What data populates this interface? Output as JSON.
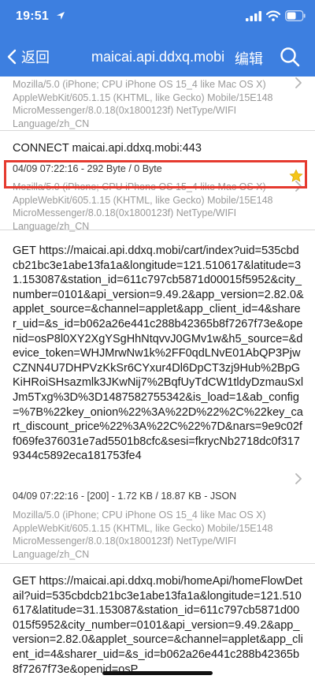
{
  "status": {
    "time": "19:51"
  },
  "nav": {
    "back_label": "返回",
    "title": "maicai.api.ddxq.mobi",
    "edit_label": "编辑"
  },
  "items": [
    {
      "ua": "Mozilla/5.0 (iPhone; CPU iPhone OS 15_4 like Mac OS X) AppleWebKit/605.1.15 (KHTML, like Gecko) Mobile/15E148 MicroMessenger/8.0.18(0x1800123f) NetType/WIFI Language/zh_CN"
    },
    {
      "request": "CONNECT maicai.api.ddxq.mobi:443",
      "meta": "04/09 07:22:16 - 292 Byte / 0 Byte",
      "ua": "Mozilla/5.0 (iPhone; CPU iPhone OS 15_4 like Mac OS X) AppleWebKit/605.1.15 (KHTML, like Gecko) Mobile/15E148 MicroMessenger/8.0.18(0x1800123f) NetType/WIFI Language/zh_CN"
    },
    {
      "request": "GET https://maicai.api.ddxq.mobi/cart/index?uid=535cbdcb21bc3e1abe13fa1a&longitude=121.510617&latitude=31.153087&station_id=611c797cb5871d00015f5952&city_number=0101&api_version=9.49.2&app_version=2.82.0&applet_source=&channel=applet&app_client_id=4&sharer_uid=&s_id=b062a26e441c288b42365b8f7267f73e&openid=osP8l0XY2XgYSgHhNtqvvJ0GMv1w&h5_source=&device_token=WHJMrwNw1k%2FF0qdLNvE01AbQP3PjwCZNN4U7DHPVzKkSr6CYxur4Dl6DpCT3zj9Hub%2BpGKiHRoiSHsazmlk3JKwNij7%2BqfUyTdCW1tldyDzmauSxlJm5Txg%3D%3D1487582755342&is_load=1&ab_config=%7B%22key_onion%22%3A%22D%22%2C%22key_cart_discount_price%22%3A%22C%22%7D&nars=9e9c02ff069fe376031e7ad5501b8cfc&sesi=fkrycNb2718dc0f3179344c5892eca181753fe4",
      "meta": "04/09 07:22:16 - [200] - 1.72 KB / 18.87 KB - JSON",
      "ua": "Mozilla/5.0 (iPhone; CPU iPhone OS 15_4 like Mac OS X) AppleWebKit/605.1.15 (KHTML, like Gecko) Mobile/15E148 MicroMessenger/8.0.18(0x1800123f) NetType/WIFI Language/zh_CN"
    },
    {
      "request": "GET https://maicai.api.ddxq.mobi/homeApi/homeFlowDetail?uid=535cbdcb21bc3e1abe13fa1a&longitude=121.510617&latitude=31.153087&station_id=611c797cb5871d00015f5952&city_number=0101&api_version=9.49.2&app_version=2.82.0&applet_source=&channel=applet&app_client_id=4&sharer_uid=&s_id=b062a26e441c288b42365b8f7267f73e&openid=osP"
    }
  ],
  "colors": {
    "header": "#3d7fe0",
    "highlight": "#e53a2f",
    "star": "#f5c518"
  }
}
